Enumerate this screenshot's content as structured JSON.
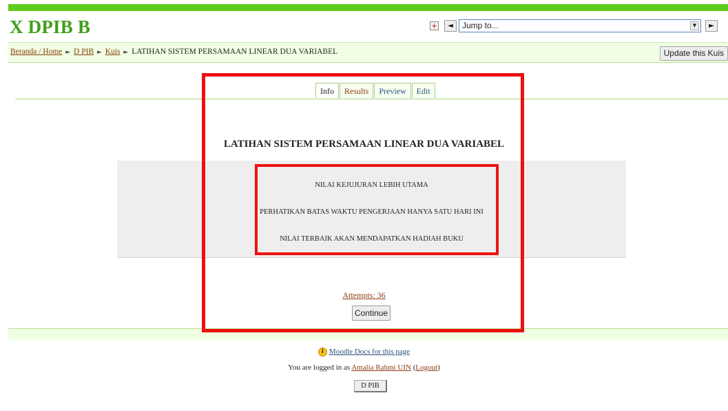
{
  "site": {
    "title": "X DPIB B"
  },
  "jump": {
    "prev": "◄",
    "placeholder": "Jump to...",
    "next": "►",
    "caret": "▼"
  },
  "breadcrumb": {
    "home": "Beranda / Home",
    "sep": "►",
    "course": "D PIB",
    "module": "Kuis",
    "current": "LATIHAN SISTEM PERSAMAAN LINEAR DUA VARIABEL"
  },
  "header": {
    "update_label": "Update this Kuis"
  },
  "tabs": [
    {
      "label": "Info"
    },
    {
      "label": "Results"
    },
    {
      "label": "Preview"
    },
    {
      "label": "Edit"
    }
  ],
  "quiz": {
    "title": "LATIHAN SISTEM PERSAMAAN LINEAR DUA VARIABEL",
    "intro": [
      "NILAI KEJUJURAN LEBIH UTAMA",
      "PERHATIKAN BATAS WAKTU PENGERJAAN HANYA SATU HARI INI",
      "NILAI TERBAIK AKAN MENDAPATKAN HADIAH BUKU"
    ],
    "attempts": "Attempts: 36",
    "continue_label": "Continue"
  },
  "footer": {
    "docs_icon": "i",
    "docs_link": "Moodle Docs for this page",
    "logged_in_prefix": "You are logged in as",
    "user_name": "Amalia Rahmi UIN",
    "logout": "Logout",
    "home_button": "D PIB"
  },
  "colors": {
    "accent_green": "#5fcc1c",
    "title_green": "#3f9f1b",
    "highlight_red": "#ee1111",
    "link_brown": "#8b3a0f"
  }
}
